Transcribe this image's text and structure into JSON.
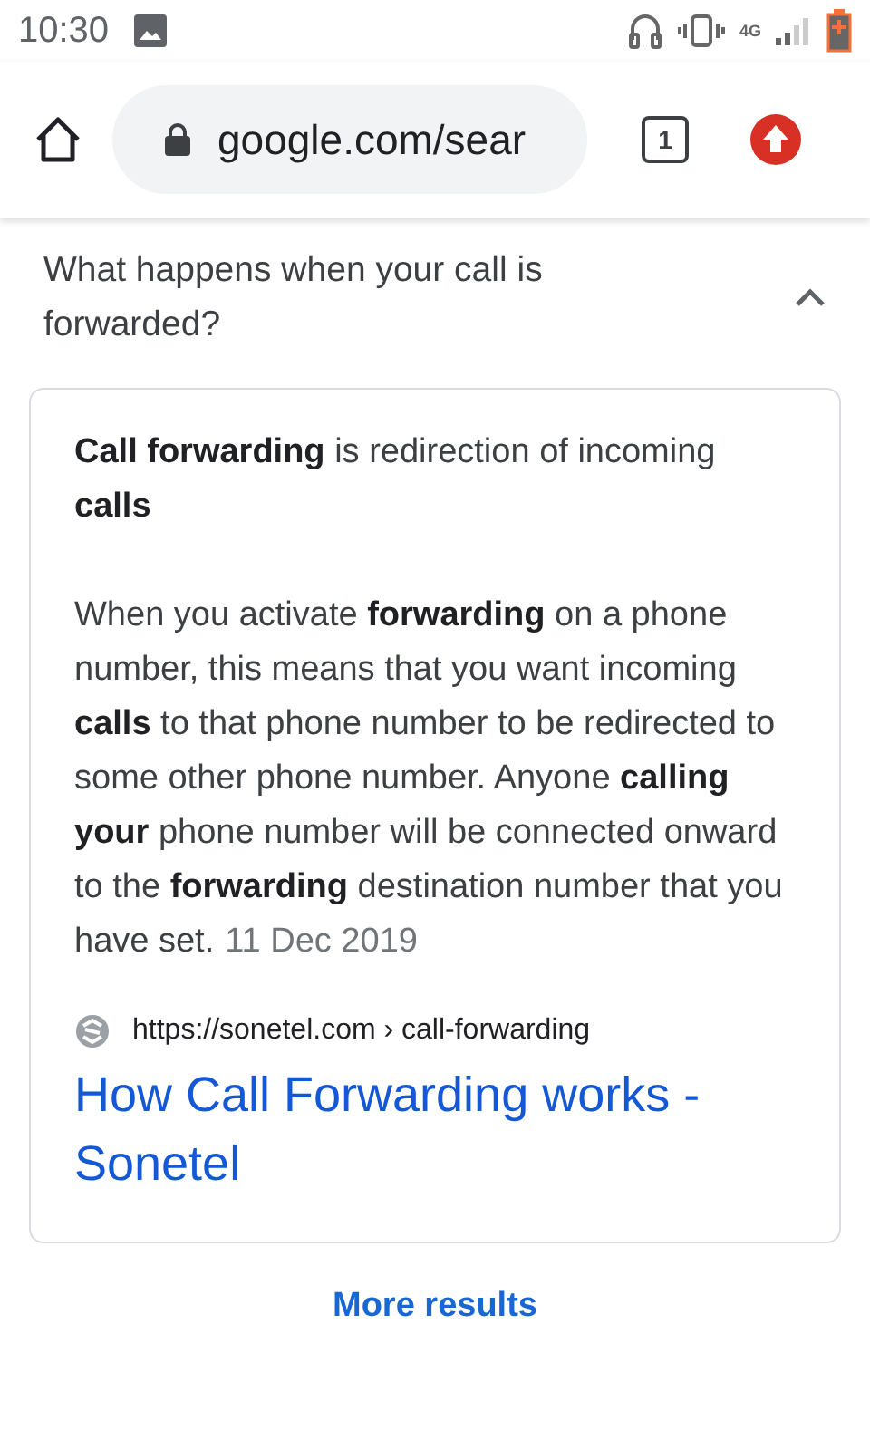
{
  "status_bar": {
    "time": "10:30",
    "network": "4G"
  },
  "toolbar": {
    "url": "google.com/sear",
    "tab_count": "1"
  },
  "question": {
    "text": "What happens when your call is forwarded?",
    "expanded": true
  },
  "answer": {
    "heading": "**Call forwarding** is redirection of incoming **calls**",
    "body": " When you activate **forwarding** on a phone number, this means that you want incoming **calls** to that phone number to be redirected to some other phone number. Anyone **calling your** phone number will be connected onward to the **forwarding** destination number that you have set.",
    "date": "11 Dec 2019",
    "source_url": "https://sonetel.com › call-forwarding",
    "link_title": "How Call Forwarding works - Sonetel"
  },
  "more_results": "More results"
}
